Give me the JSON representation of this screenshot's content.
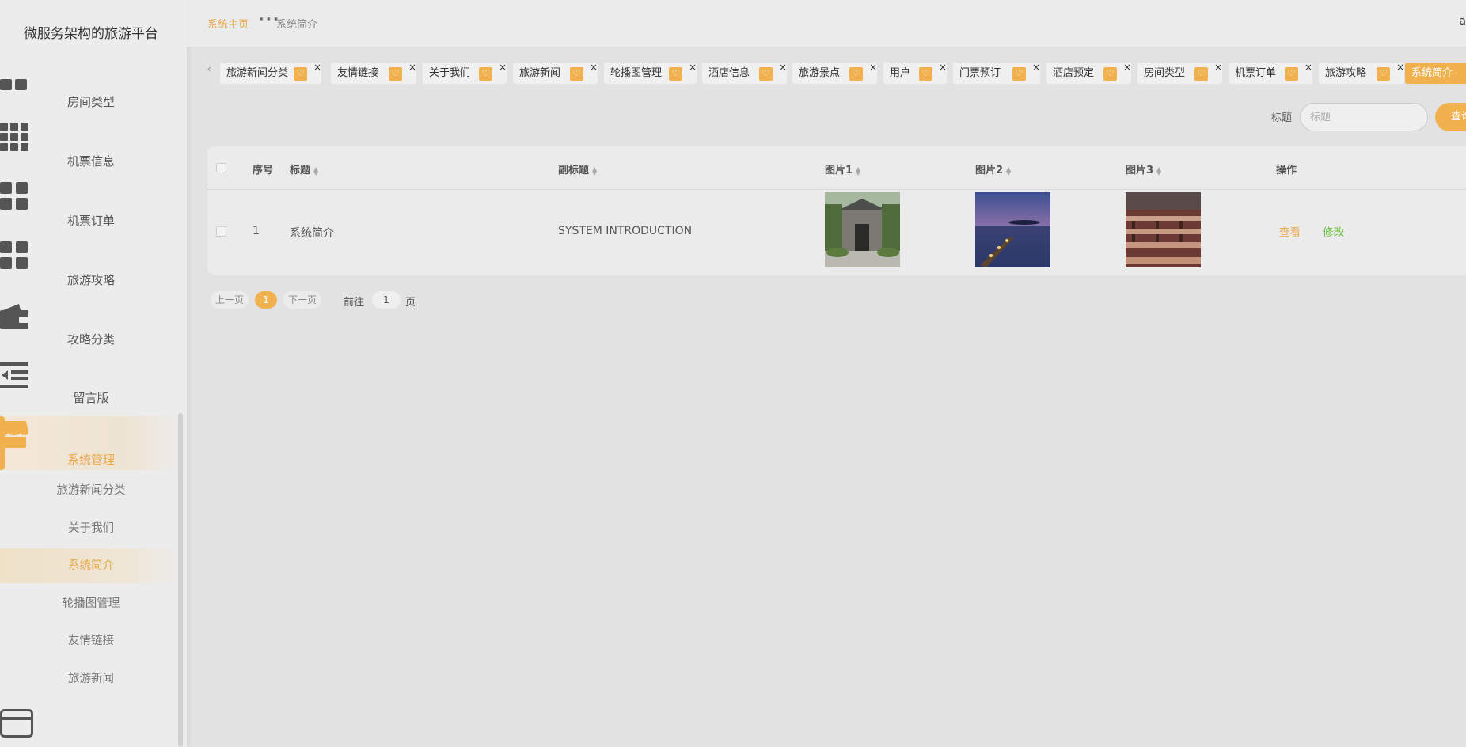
{
  "sidebar": {
    "title": "微服务架构的旅游平台",
    "menu": [
      {
        "label": "房间类型",
        "icon": "grid-two-icon"
      },
      {
        "label": "机票信息",
        "icon": "grid-nine-icon"
      },
      {
        "label": "机票订单",
        "icon": "grid-four-icon"
      },
      {
        "label": "旅游攻略",
        "icon": "grid-four-icon"
      },
      {
        "label": "攻略分类",
        "icon": "wallet-icon"
      },
      {
        "label": "留言版",
        "icon": "list-indent-icon"
      },
      {
        "label": "系统管理",
        "icon": "store-icon"
      }
    ],
    "submenu": [
      "旅游新闻分类",
      "关于我们",
      "系统简介",
      "轮播图管理",
      "友情链接",
      "旅游新闻"
    ],
    "bottom_icon": "card-icon"
  },
  "header": {
    "home": "系统主页",
    "dots": "•••",
    "current": "系统简介",
    "user_initial": "a"
  },
  "tags": [
    "旅游新闻分类",
    "友情链接",
    "关于我们",
    "旅游新闻",
    "轮播图管理",
    "酒店信息",
    "旅游景点",
    "用户",
    "门票预订",
    "酒店预定",
    "房间类型",
    "机票订单",
    "旅游攻略",
    "系统简介"
  ],
  "tag_close": "×",
  "tag_arrow": "‹",
  "search": {
    "label": "标题",
    "placeholder": "标题",
    "button": "查询"
  },
  "table": {
    "headers": [
      "序号",
      "标题",
      "副标题",
      "图片1",
      "图片2",
      "图片3",
      "操作"
    ],
    "rows": [
      {
        "index": "1",
        "title": "系统简介",
        "subtitle": "SYSTEM INTRODUCTION",
        "ops": [
          "查看",
          "修改"
        ]
      }
    ]
  },
  "pagination": {
    "prev": "上一页",
    "page": "1",
    "next": "下一页",
    "goto": "前往",
    "goto_value": "1",
    "page_unit": "页"
  },
  "colors": {
    "accent": "#f0b14e",
    "edit": "#67c23a"
  }
}
